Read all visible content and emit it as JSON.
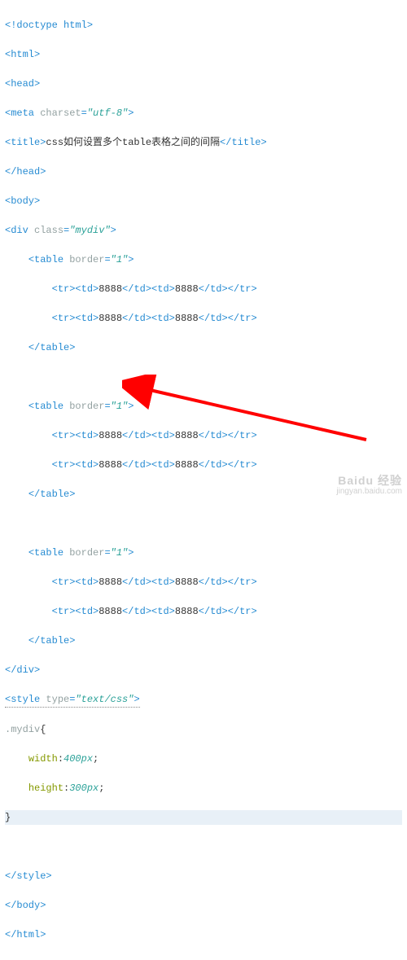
{
  "code": {
    "doctype": "!doctype html",
    "html_open": "html",
    "head_open": "head",
    "meta_tag": "meta",
    "meta_attr": "charset",
    "meta_val": "\"utf-8\"",
    "title_tag": "title",
    "title_text": "css如何设置多个table表格之间的间隔",
    "head_close": "/head",
    "body_open": "body",
    "div_tag": "div",
    "div_attr": "class",
    "div_val": "\"mydiv\"",
    "table_tag": "table",
    "table_attr": "border",
    "table_val": "\"1\"",
    "tr_tag": "tr",
    "td_tag": "td",
    "cell_val": "8888",
    "table_close": "/table",
    "div_close": "/div",
    "style_tag": "style",
    "style_attr": "type",
    "style_val": "\"text/css\"",
    "selector": ".mydiv",
    "brace_open": "{",
    "prop1": "width",
    "val1": "400px",
    "prop2": "height",
    "val2": "300px",
    "brace_close": "}",
    "style_close": "/style",
    "body_close": "/body",
    "html_close": "/html"
  },
  "watermark": {
    "brand": "Baidu 经验",
    "url": "jingyan.baidu.com"
  }
}
